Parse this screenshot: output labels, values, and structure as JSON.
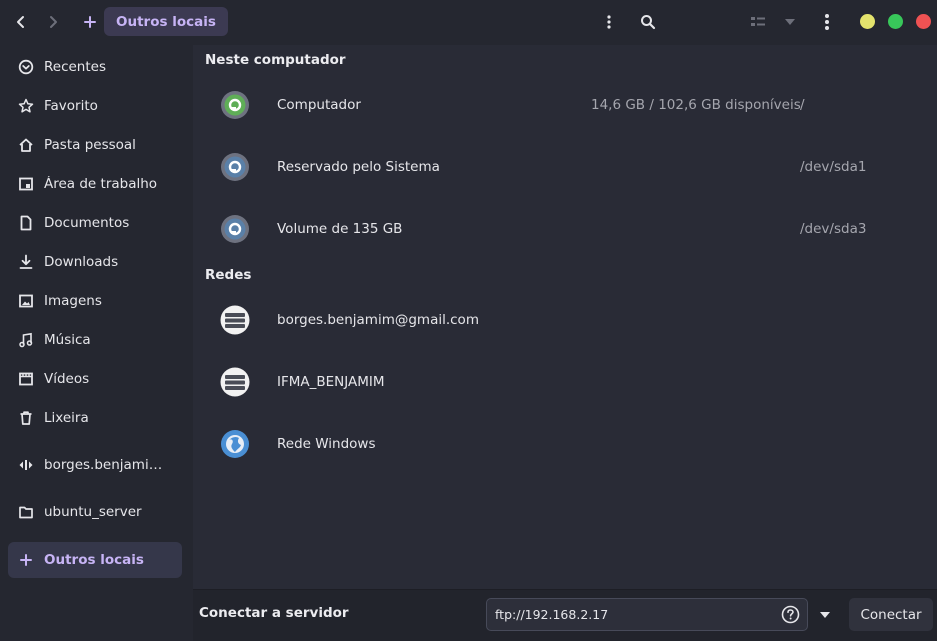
{
  "header": {
    "location": "Outros locais",
    "icons": [
      "back-icon",
      "forward-icon",
      "plus-icon",
      "more-vertical-icon",
      "search-icon",
      "list-view-icon",
      "chevron-down-icon",
      "menu-icon"
    ],
    "window_controls": [
      "minimize",
      "maximize",
      "close"
    ]
  },
  "colors": {
    "accent": "#c7b4f5",
    "minimize": "#e4e36d",
    "maximize": "#38c75a",
    "close": "#ef5253"
  },
  "sidebar": {
    "items": [
      {
        "label": "Recentes",
        "icon": "clock-icon"
      },
      {
        "label": "Favorito",
        "icon": "star-icon"
      },
      {
        "label": "Pasta pessoal",
        "icon": "home-icon"
      },
      {
        "label": "Área de trabalho",
        "icon": "desktop-icon"
      },
      {
        "label": "Documentos",
        "icon": "document-icon"
      },
      {
        "label": "Downloads",
        "icon": "download-icon"
      },
      {
        "label": "Imagens",
        "icon": "image-icon"
      },
      {
        "label": "Música",
        "icon": "music-icon"
      },
      {
        "label": "Vídeos",
        "icon": "video-icon"
      },
      {
        "label": "Lixeira",
        "icon": "trash-icon"
      },
      {
        "label": "borges.benjamim@gmail.com",
        "display": "borges.benjamim...",
        "icon": "network-share-icon"
      },
      {
        "label": "ubuntu_server",
        "icon": "folder-icon"
      },
      {
        "label": "Outros locais",
        "icon": "plus-icon",
        "active": true
      }
    ]
  },
  "main": {
    "computer_section": {
      "title": "Neste computador",
      "devices": [
        {
          "name": "Computador",
          "space": "14,6 GB  /  102,6 GB disponíveis",
          "mount": "/",
          "icon": "drive-root-icon"
        },
        {
          "name": "Reservado pelo Sistema",
          "space": "",
          "mount": "/dev/sda1",
          "icon": "drive-icon"
        },
        {
          "name": "Volume de 135 GB",
          "space": "",
          "mount": "/dev/sda3",
          "icon": "drive-icon"
        }
      ]
    },
    "network_section": {
      "title": "Redes",
      "items": [
        {
          "name": "borges.benjamim@gmail.com",
          "icon": "server-icon"
        },
        {
          "name": "IFMA_BENJAMIM",
          "icon": "server-icon"
        },
        {
          "name": "Rede Windows",
          "icon": "network-globe-icon"
        }
      ]
    }
  },
  "bottom": {
    "label": "Conectar a servidor",
    "server_value": "ftp://192.168.2.17",
    "connect_label": "Conectar"
  }
}
